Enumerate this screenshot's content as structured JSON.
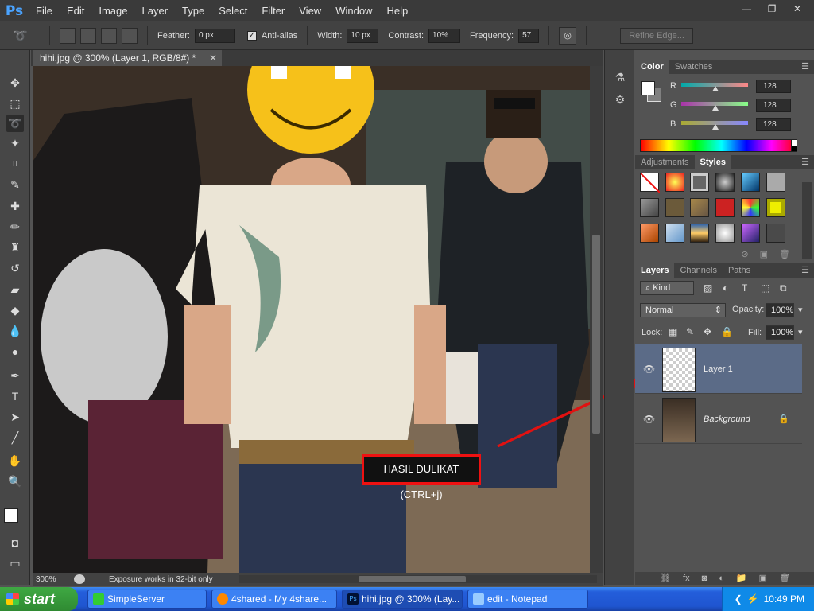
{
  "app": {
    "logo": "Ps"
  },
  "menu": [
    "File",
    "Edit",
    "Image",
    "Layer",
    "Type",
    "Select",
    "Filter",
    "View",
    "Window",
    "Help"
  ],
  "window_controls": {
    "minimize": "—",
    "restore": "❐",
    "close": "✕"
  },
  "options": {
    "feather_label": "Feather:",
    "feather_value": "0 px",
    "antialias_label": "Anti-alias",
    "width_label": "Width:",
    "width_value": "10 px",
    "contrast_label": "Contrast:",
    "contrast_value": "10%",
    "frequency_label": "Frequency:",
    "frequency_value": "57",
    "refine_edge": "Refine Edge..."
  },
  "document": {
    "tab_title": "hihi.jpg @ 300% (Layer 1, RGB/8#) *",
    "close": "✕",
    "zoom": "300%",
    "status": "Exposure works in 32-bit only"
  },
  "annotation": {
    "text": "HASIL DULIKAT (CTRL+j)",
    "color": "#e11111"
  },
  "color_panel": {
    "tabs": [
      "Color",
      "Swatches"
    ],
    "channels": [
      {
        "label": "R",
        "value": "128"
      },
      {
        "label": "G",
        "value": "128"
      },
      {
        "label": "B",
        "value": "128"
      }
    ],
    "foreground": "#ffffff",
    "background": "#808080"
  },
  "styles_panel": {
    "tabs": [
      "Adjustments",
      "Styles"
    ]
  },
  "layers_panel": {
    "tabs": [
      "Layers",
      "Channels",
      "Paths"
    ],
    "filter_kind": "Kind",
    "blend_mode": "Normal",
    "opacity_label": "Opacity:",
    "opacity_value": "100%",
    "lock_label": "Lock:",
    "fill_label": "Fill:",
    "fill_value": "100%",
    "layers": [
      {
        "name": "Layer 1",
        "selected": true
      },
      {
        "name": "Background",
        "locked": true
      }
    ]
  },
  "taskbar": {
    "start": "start",
    "tasks": [
      "SimpleServer",
      "4shared - My 4share...",
      "hihi.jpg @ 300% (Lay...",
      "edit - Notepad"
    ],
    "clock": "10:49 PM"
  }
}
